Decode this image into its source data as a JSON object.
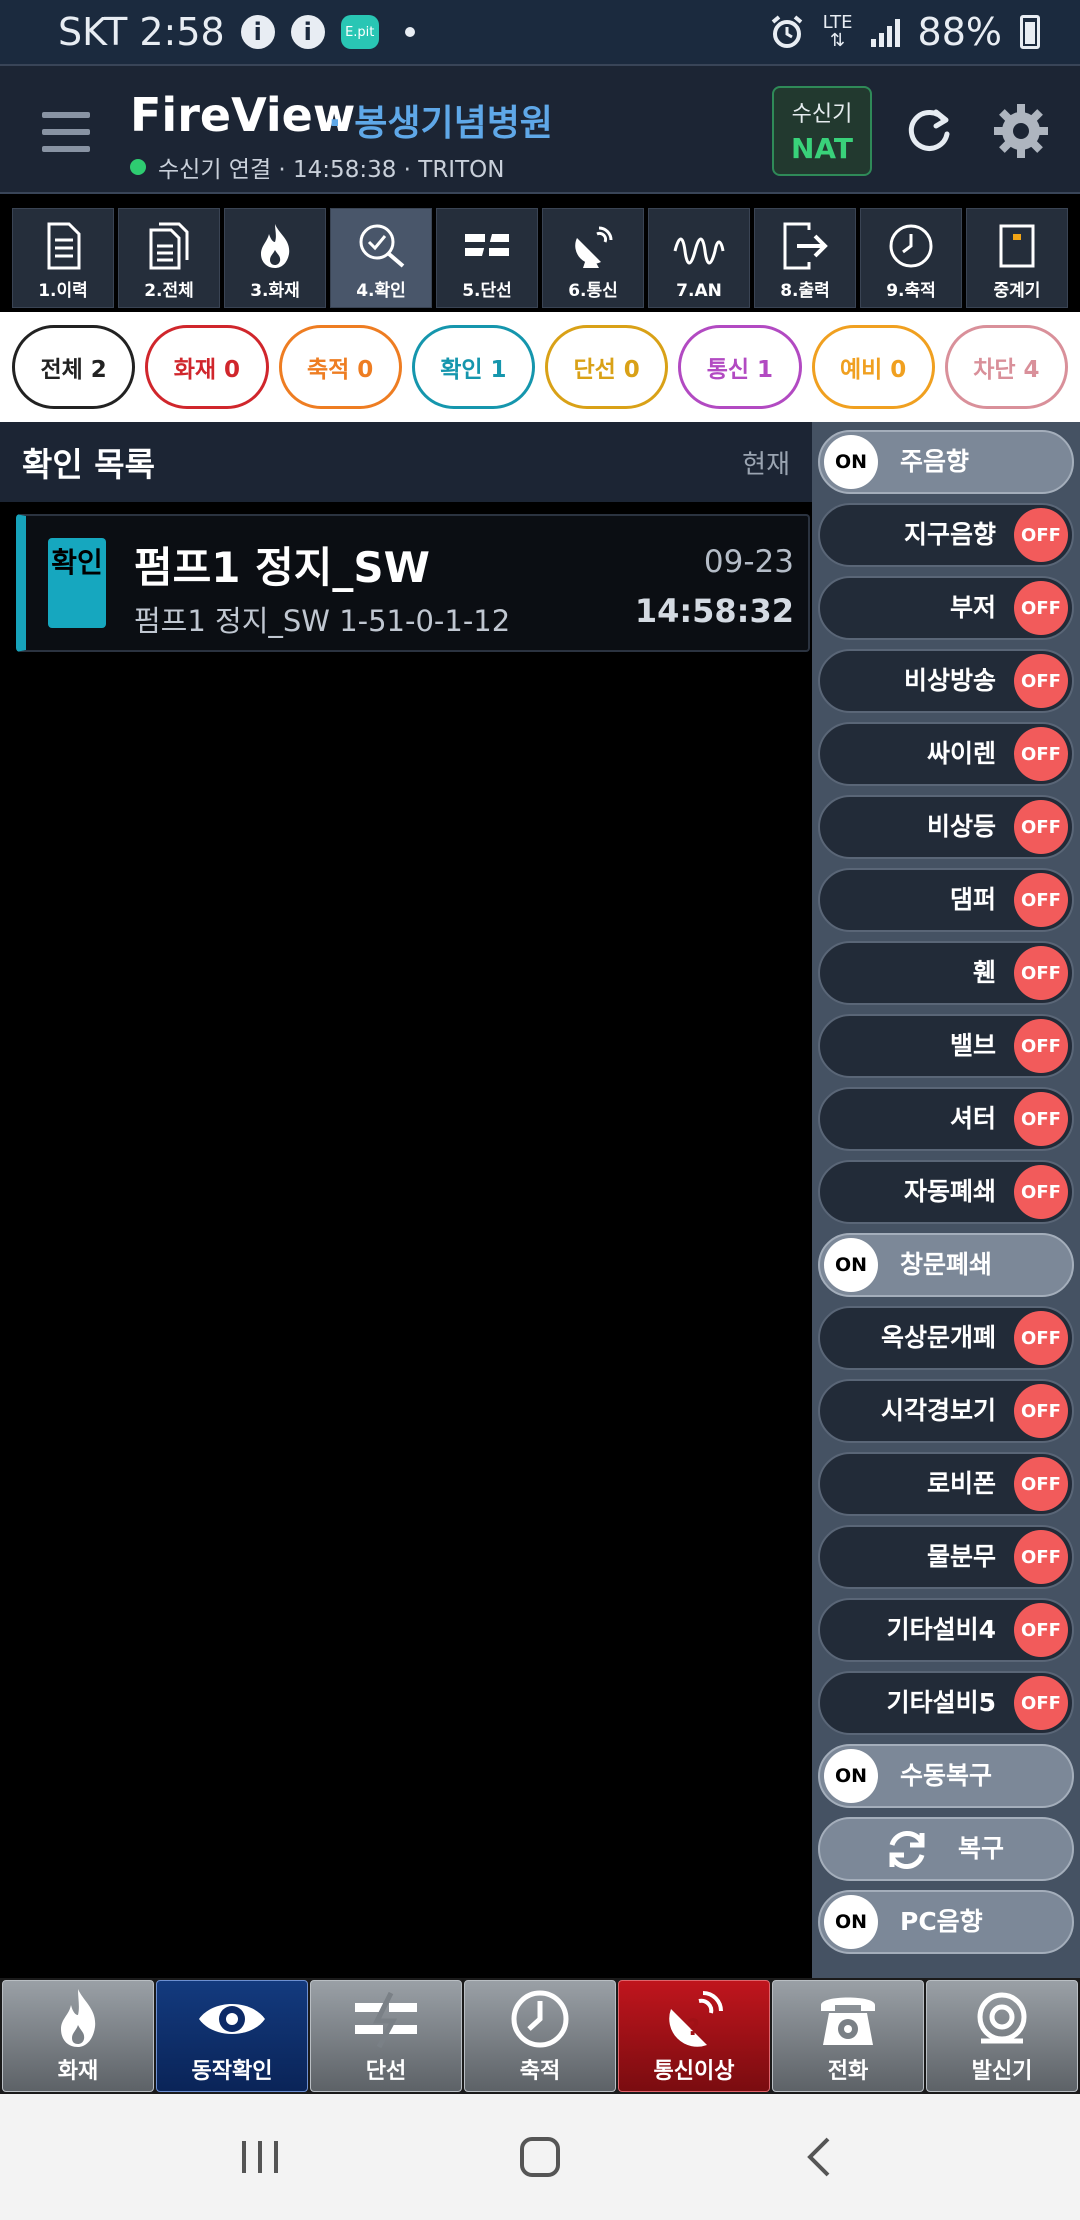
{
  "status_bar": {
    "carrier_time": "SKT 2:58",
    "epit_label": "E.pit",
    "network": "LTE",
    "battery": "88%"
  },
  "header": {
    "app_title": "FireView",
    "hospital": "· 봉생기념병원",
    "connection": "수신기 연결 · 14:58:38 · TRITON",
    "receiver_label": "수신기",
    "receiver_mode": "NAT"
  },
  "toolbar": [
    {
      "label": "1.이력",
      "icon": "document-icon"
    },
    {
      "label": "2.전체",
      "icon": "documents-icon"
    },
    {
      "label": "3.화재",
      "icon": "fire-icon"
    },
    {
      "label": "4.확인",
      "icon": "check-search-icon"
    },
    {
      "label": "5.단선",
      "icon": "broken-line-icon"
    },
    {
      "label": "6.통신",
      "icon": "satellite-icon"
    },
    {
      "label": "7.AN",
      "icon": "wave-icon"
    },
    {
      "label": "8.출력",
      "icon": "output-icon"
    },
    {
      "label": "9.축적",
      "icon": "clock-icon"
    },
    {
      "label": "중계기",
      "icon": "repeater-icon"
    }
  ],
  "filters": [
    {
      "label": "전체 2",
      "color": "#222222"
    },
    {
      "label": "화재 0",
      "color": "#d0262c"
    },
    {
      "label": "축적 0",
      "color": "#ee7d22"
    },
    {
      "label": "확인 1",
      "color": "#1596ad"
    },
    {
      "label": "단선 0",
      "color": "#d9a117"
    },
    {
      "label": "통신 1",
      "color": "#b24ac2"
    },
    {
      "label": "예비 0",
      "color": "#f0a020"
    },
    {
      "label": "차단 4",
      "color": "#d9909a"
    }
  ],
  "list": {
    "title": "확인 목록",
    "now_label": "현재",
    "events": [
      {
        "badge": "확인",
        "title": "펌프1 정지_SW",
        "subtitle": "펌프1 정지_SW 1-51-0-1-12",
        "date": "09-23",
        "time": "14:58:32"
      }
    ]
  },
  "controls": [
    {
      "label": "주음향",
      "state": "ON"
    },
    {
      "label": "지구음향",
      "state": "OFF"
    },
    {
      "label": "부저",
      "state": "OFF"
    },
    {
      "label": "비상방송",
      "state": "OFF"
    },
    {
      "label": "싸이렌",
      "state": "OFF"
    },
    {
      "label": "비상등",
      "state": "OFF"
    },
    {
      "label": "댐퍼",
      "state": "OFF"
    },
    {
      "label": "휀",
      "state": "OFF"
    },
    {
      "label": "밸브",
      "state": "OFF"
    },
    {
      "label": "셔터",
      "state": "OFF"
    },
    {
      "label": "자동폐쇄",
      "state": "OFF"
    },
    {
      "label": "창문폐쇄",
      "state": "ON"
    },
    {
      "label": "옥상문개폐",
      "state": "OFF"
    },
    {
      "label": "시각경보기",
      "state": "OFF"
    },
    {
      "label": "로비폰",
      "state": "OFF"
    },
    {
      "label": "물분무",
      "state": "OFF"
    },
    {
      "label": "기타설비4",
      "state": "OFF"
    },
    {
      "label": "기타설비5",
      "state": "OFF"
    },
    {
      "label": "수동복구",
      "state": "ON"
    },
    {
      "label": "복구",
      "state": "ACTION"
    },
    {
      "label": "PC음향",
      "state": "ON"
    }
  ],
  "bottom_bar": [
    {
      "label": "화재",
      "style": "gray",
      "icon": "fire-icon"
    },
    {
      "label": "동작확인",
      "style": "blue",
      "icon": "eye-icon"
    },
    {
      "label": "단선",
      "style": "gray",
      "icon": "broken-line-icon"
    },
    {
      "label": "축적",
      "style": "gray",
      "icon": "clock-icon"
    },
    {
      "label": "통신이상",
      "style": "red",
      "icon": "satellite-warning-icon"
    },
    {
      "label": "전화",
      "style": "gray",
      "icon": "telephone-icon"
    },
    {
      "label": "발신기",
      "style": "gray",
      "icon": "transmitter-icon"
    }
  ]
}
